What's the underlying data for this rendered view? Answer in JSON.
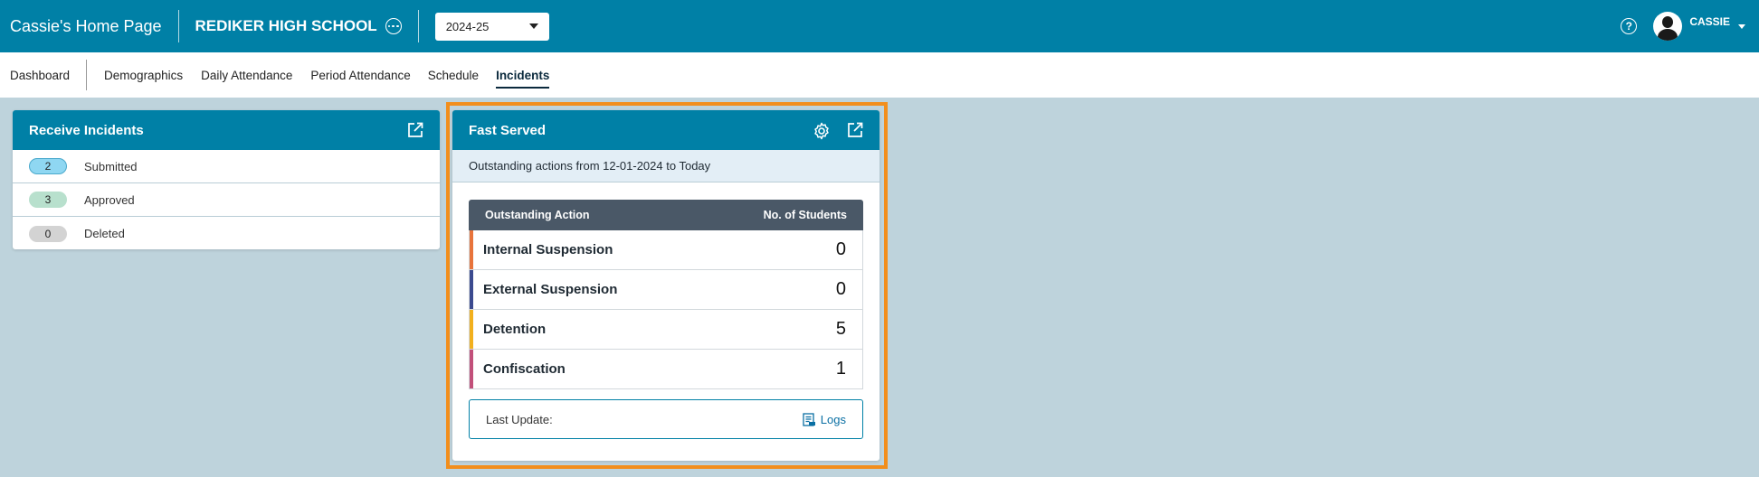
{
  "header": {
    "home_title": "Cassie's Home Page",
    "school_name": "REDIKER HIGH SCHOOL",
    "year": "2024-25",
    "user": "CASSIE",
    "help_glyph": "?"
  },
  "nav": {
    "tabs": [
      {
        "label": "Dashboard"
      },
      {
        "label": "Demographics"
      },
      {
        "label": "Daily Attendance"
      },
      {
        "label": "Period Attendance"
      },
      {
        "label": "Schedule"
      },
      {
        "label": "Incidents"
      }
    ],
    "active": "Incidents"
  },
  "receive_incidents": {
    "title": "Receive Incidents",
    "rows": [
      {
        "count": "2",
        "label": "Submitted"
      },
      {
        "count": "3",
        "label": "Approved"
      },
      {
        "count": "0",
        "label": "Deleted"
      }
    ]
  },
  "fast_served": {
    "title": "Fast Served",
    "subtitle": "Outstanding actions from 12-01-2024 to Today",
    "columns": [
      "Outstanding Action",
      "No. of Students"
    ],
    "rows": [
      {
        "action": "Internal Suspension",
        "count": "0",
        "color": "#e8743b"
      },
      {
        "action": "External Suspension",
        "count": "0",
        "color": "#3b4a8f"
      },
      {
        "action": "Detention",
        "count": "5",
        "color": "#f2b01e"
      },
      {
        "action": "Confiscation",
        "count": "1",
        "color": "#c2507a"
      }
    ],
    "last_update_label": "Last Update:",
    "logs_label": "Logs"
  },
  "colors": {
    "brand": "#0080a6",
    "highlight": "#f28e1c",
    "table_header": "#4a5867"
  }
}
